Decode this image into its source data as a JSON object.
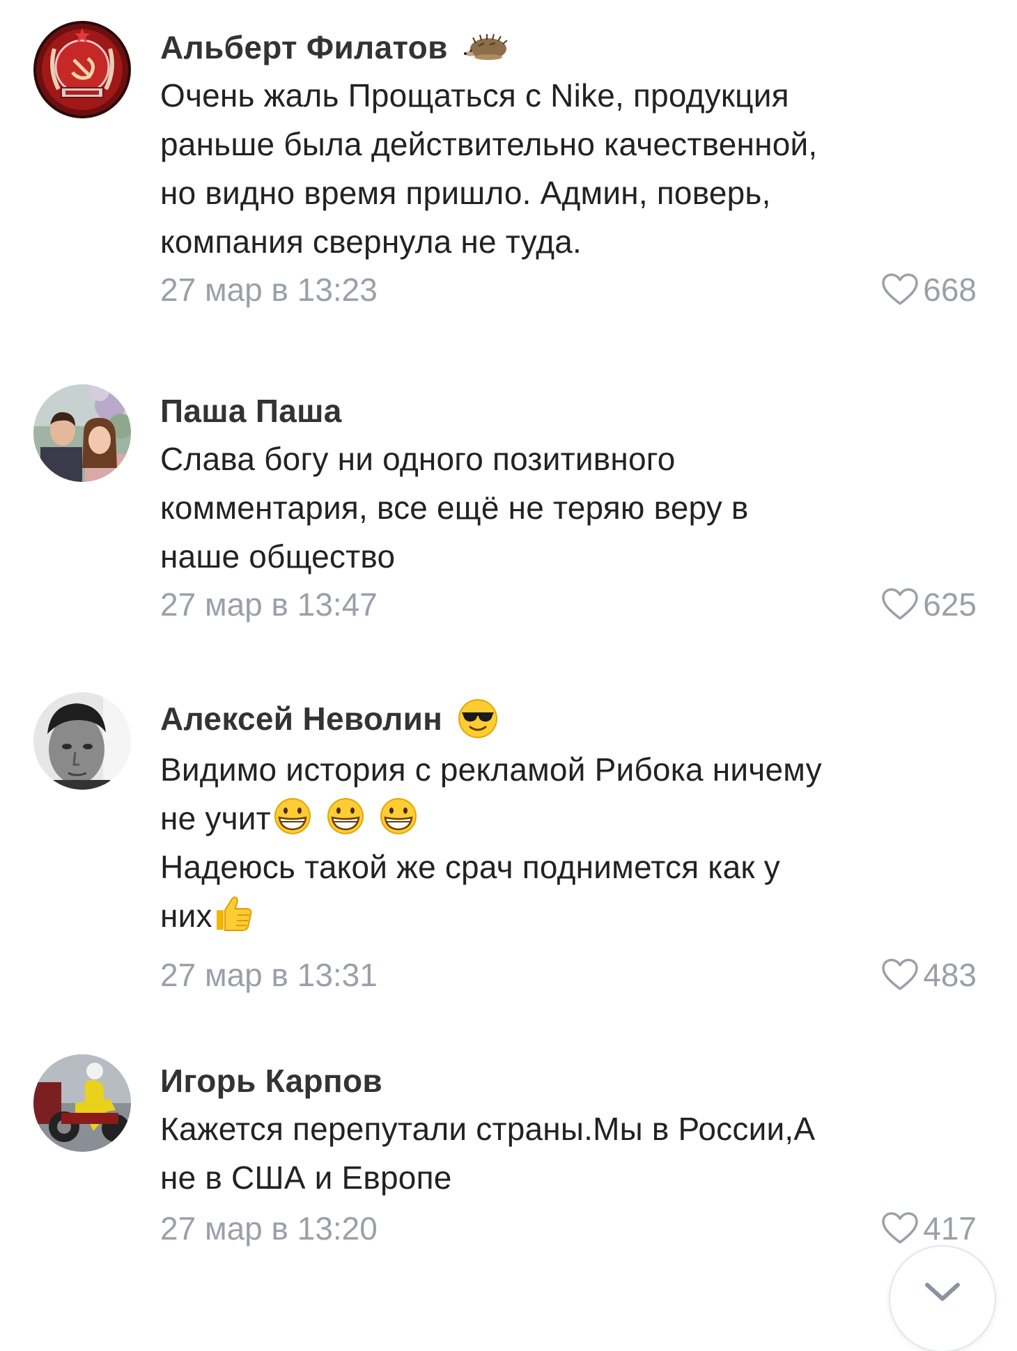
{
  "comments": [
    {
      "author": "Альберт Филатов",
      "author_emoji": "hedgehog",
      "lines": [
        "Очень жаль Прощаться с Nike, продукция",
        "раньше была действительно качественной,",
        "но видно время пришло. Админ, поверь,",
        "компания свернула не туда."
      ],
      "timestamp": "27 мар в 13:23",
      "likes": "668",
      "avatar": "ussr-emblem"
    },
    {
      "author": "Паша Паша",
      "lines": [
        "Слава богу ни одного позитивного",
        "комментария, все ещё не теряю веру в",
        "наше общество"
      ],
      "timestamp": "27 мар в 13:47",
      "likes": "625",
      "avatar": "couple-photo"
    },
    {
      "author": "Алексей Неволин",
      "author_emoji": "smiling-face-with-sunglasses",
      "line1": "Видимо история с рекламой Рибока ничему",
      "line2": "не учит",
      "line2_emojis": [
        "grinning-face",
        "grinning-face",
        "grinning-face"
      ],
      "line3": "Надеюсь такой же срач поднимется как у",
      "line4": "них",
      "line4_emoji": "thumbs-up",
      "timestamp": "27 мар в 13:31",
      "likes": "483",
      "avatar": "bw-portrait"
    },
    {
      "author": "Игорь Карпов",
      "lines": [
        "Кажется перепутали страны.Мы в России,А",
        "не в США и Европе"
      ],
      "timestamp": "27 мар в 13:20",
      "likes": "417",
      "avatar": "motorcycle-photo"
    }
  ],
  "colors": {
    "text": "#222222",
    "author": "#333333",
    "meta": "#9aa0a8",
    "background": "#ffffff"
  },
  "icons": {
    "like": "heart-outline-icon",
    "scroll": "chevron-down-icon"
  }
}
